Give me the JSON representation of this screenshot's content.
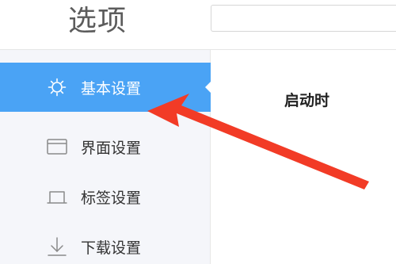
{
  "header": {
    "title": "选项",
    "search": {
      "value": "",
      "placeholder": ""
    }
  },
  "sidebar": {
    "items": [
      {
        "label": "基本设置",
        "icon": "gear-icon",
        "active": true
      },
      {
        "label": "界面设置",
        "icon": "window-icon",
        "active": false
      },
      {
        "label": "标签设置",
        "icon": "tab-icon",
        "active": false
      },
      {
        "label": "下载设置",
        "icon": "download-icon",
        "active": false
      }
    ]
  },
  "main": {
    "section_heading": "启动时"
  },
  "colors": {
    "accent": "#4aa3f5",
    "sidebar_bg": "#f5f6fa",
    "annotation_arrow": "#f23b26"
  }
}
